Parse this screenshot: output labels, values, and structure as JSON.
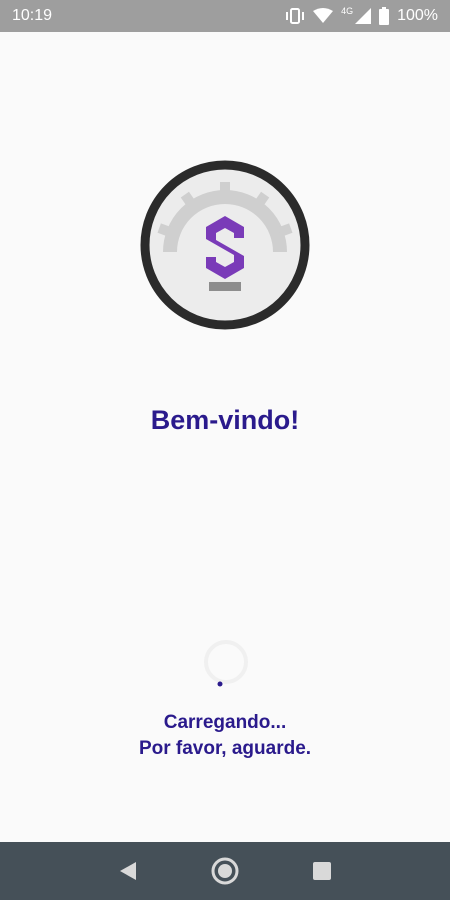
{
  "status_bar": {
    "time": "10:19",
    "network_label": "4G",
    "battery_percent": "100%",
    "icons": [
      "vibrate-icon",
      "wifi-icon",
      "signal-icon",
      "battery-icon"
    ]
  },
  "app": {
    "logo_icon": "gauge-s-logo-icon",
    "welcome_text": "Bem-vindo!",
    "loading_line1": "Carregando...",
    "loading_line2": "Por favor, aguarde."
  },
  "nav_bar": {
    "buttons": [
      "back-icon",
      "home-icon",
      "recents-icon"
    ]
  },
  "colors": {
    "accent": "#2a1a8c",
    "logo_purple": "#7a3bb8",
    "status_bar": "#9e9e9e",
    "nav_bar": "#455058"
  }
}
